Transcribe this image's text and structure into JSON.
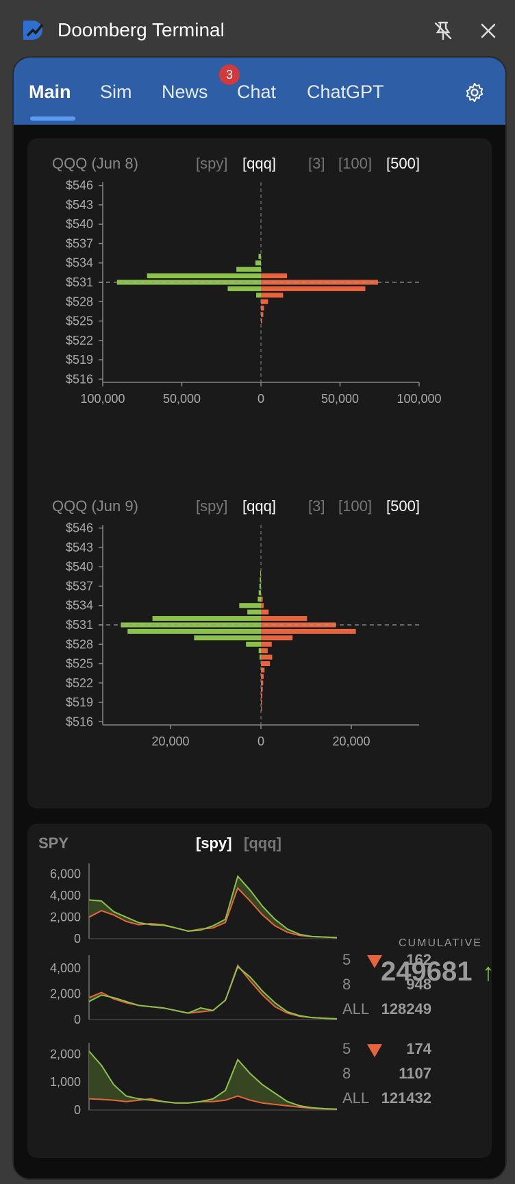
{
  "window": {
    "title": "Doomberg Terminal",
    "pin_icon": "pin-off-icon",
    "close_icon": "close-icon",
    "logo_icon": "doomberg-logo-icon"
  },
  "tabs": [
    {
      "label": "Main",
      "active": true
    },
    {
      "label": "Sim",
      "active": false
    },
    {
      "label": "News",
      "active": false,
      "badge": "3"
    },
    {
      "label": "Chat",
      "active": false
    },
    {
      "label": "ChatGPT",
      "active": false
    }
  ],
  "settings_icon": "gear-icon",
  "colors": {
    "tabbar": "#2e5ea6",
    "green": "#8bc34a",
    "orange": "#e8643c",
    "badge": "#d23a3a"
  },
  "dist_charts": [
    {
      "title": "QQQ (Jun 8)",
      "symbol_options": [
        "[spy]",
        "[qqq]"
      ],
      "selected_symbol": "[qqq]",
      "count_options": [
        "[3]",
        "[100]",
        "[500]"
      ],
      "selected_count": "[500]"
    },
    {
      "title": "QQQ (Jun 9)",
      "symbol_options": [
        "[spy]",
        "[qqq]"
      ],
      "selected_symbol": "[qqq]",
      "count_options": [
        "[3]",
        "[100]",
        "[500]"
      ],
      "selected_count": "[500]"
    }
  ],
  "spy_panel": {
    "title": "SPY",
    "symbol_options": [
      "[spy]",
      "[qqq]"
    ],
    "selected_symbol": "[spy]",
    "cumulative_label": "CUMULATIVE",
    "cumulative_value": "249681",
    "cumulative_arrow": "↑",
    "groups": [
      {
        "rows": [
          {
            "label": "5",
            "value": "162",
            "down": true
          },
          {
            "label": "8",
            "value": "948",
            "down": false
          },
          {
            "label": "ALL",
            "value": "128249",
            "down": false
          }
        ]
      },
      {
        "rows": [
          {
            "label": "5",
            "value": "174",
            "down": true
          },
          {
            "label": "8",
            "value": "1107",
            "down": false
          },
          {
            "label": "ALL",
            "value": "121432",
            "down": false
          }
        ]
      }
    ]
  },
  "chart_data": [
    {
      "type": "bar",
      "orientation": "horizontal-diverging",
      "title": "QQQ (Jun 8)",
      "y_ticks": [
        "$546",
        "$543",
        "$540",
        "$537",
        "$534",
        "$531",
        "$528",
        "$525",
        "$522",
        "$519",
        "$516"
      ],
      "x_ticks": [
        "100,000",
        "50,000",
        "0",
        "50,000",
        "100,000"
      ],
      "xlim": [
        -100000,
        100000
      ],
      "ylim": [
        515.5,
        546.5
      ],
      "reference_price": 531,
      "series": [
        {
          "color": "#8bc34a",
          "side": "left",
          "prices": [
            535,
            534,
            533,
            532,
            531,
            530,
            529
          ],
          "values": [
            1500,
            3500,
            15500,
            72000,
            91000,
            21000,
            3000
          ]
        },
        {
          "color": "#e8643c",
          "side": "right",
          "prices": [
            532,
            531,
            530,
            529,
            528,
            527,
            526,
            525
          ],
          "values": [
            16500,
            74000,
            66000,
            14000,
            4500,
            2000,
            1500,
            800
          ]
        }
      ]
    },
    {
      "type": "bar",
      "orientation": "horizontal-diverging",
      "title": "QQQ (Jun 9)",
      "y_ticks": [
        "$546",
        "$543",
        "$540",
        "$537",
        "$534",
        "$531",
        "$528",
        "$525",
        "$522",
        "$519",
        "$516"
      ],
      "x_ticks": [
        "20,000",
        "0",
        "20,000"
      ],
      "xlim": [
        -35000,
        35000
      ],
      "ylim": [
        515.5,
        546.5
      ],
      "reference_price": 531,
      "series": [
        {
          "color": "#8bc34a",
          "side": "left",
          "prices": [
            539,
            538,
            537,
            536,
            535,
            534,
            533,
            532,
            531,
            530,
            529,
            528,
            527,
            526
          ],
          "values": [
            150,
            250,
            350,
            500,
            700,
            4800,
            3000,
            24000,
            31000,
            29500,
            14800,
            3300,
            500,
            300
          ]
        },
        {
          "color": "#e8643c",
          "side": "right",
          "prices": [
            535,
            534,
            533,
            532,
            531,
            530,
            529,
            528,
            527,
            526,
            525,
            524,
            523,
            522,
            521,
            520,
            519,
            518
          ],
          "values": [
            400,
            600,
            1700,
            10200,
            16600,
            21000,
            7000,
            2400,
            1500,
            2500,
            2000,
            800,
            600,
            500,
            400,
            300,
            250,
            200
          ]
        }
      ]
    },
    {
      "type": "area",
      "title": "SPY",
      "y_ticks": [
        "6,000",
        "4,000",
        "2,000",
        "0"
      ],
      "ylim": [
        0,
        7000
      ],
      "x": [
        0,
        10,
        20,
        30,
        40,
        50,
        60,
        70,
        80,
        90,
        100,
        110,
        120,
        130,
        140,
        150,
        160,
        170,
        180,
        190,
        200
      ],
      "series": [
        {
          "color": "#8bc34a",
          "values": [
            3600,
            3500,
            2500,
            2000,
            1500,
            1300,
            1250,
            1000,
            700,
            800,
            1200,
            1800,
            5800,
            4500,
            3000,
            1800,
            900,
            400,
            200,
            150,
            100
          ]
        },
        {
          "color": "#e8643c",
          "values": [
            2000,
            2600,
            2200,
            1600,
            1300,
            1400,
            1300,
            1000,
            700,
            900,
            1000,
            1500,
            4700,
            3500,
            2200,
            1200,
            600,
            300,
            200,
            150,
            100
          ]
        }
      ]
    },
    {
      "type": "area",
      "title": "",
      "y_ticks": [
        "4,000",
        "2,000",
        "0"
      ],
      "ylim": [
        0,
        5000
      ],
      "x": [
        0,
        10,
        20,
        30,
        40,
        50,
        60,
        70,
        80,
        90,
        100,
        110,
        120,
        130,
        140,
        150,
        160,
        170,
        180,
        190,
        200
      ],
      "series": [
        {
          "color": "#8bc34a",
          "values": [
            1400,
            1900,
            1700,
            1400,
            1100,
            1000,
            900,
            700,
            500,
            900,
            700,
            1500,
            4100,
            3300,
            2200,
            1300,
            600,
            300,
            150,
            100,
            50
          ]
        },
        {
          "color": "#e8643c",
          "values": [
            1700,
            2100,
            1600,
            1300,
            1100,
            1000,
            900,
            700,
            500,
            600,
            700,
            1500,
            4200,
            3000,
            1900,
            1000,
            500,
            250,
            150,
            100,
            50
          ]
        }
      ]
    },
    {
      "type": "area",
      "title": "",
      "y_ticks": [
        "2,000",
        "1,000",
        "0"
      ],
      "ylim": [
        0,
        2400
      ],
      "x": [
        0,
        10,
        20,
        30,
        40,
        50,
        60,
        70,
        80,
        90,
        100,
        110,
        120,
        130,
        140,
        150,
        160,
        170,
        180,
        190,
        200
      ],
      "series": [
        {
          "color": "#8bc34a",
          "values": [
            2100,
            1600,
            900,
            500,
            400,
            350,
            300,
            250,
            250,
            300,
            400,
            700,
            1800,
            1300,
            900,
            600,
            300,
            150,
            80,
            50,
            30
          ]
        },
        {
          "color": "#e8643c",
          "values": [
            400,
            380,
            350,
            300,
            350,
            400,
            300,
            250,
            250,
            300,
            300,
            350,
            500,
            350,
            250,
            200,
            150,
            100,
            60,
            40,
            30
          ]
        }
      ]
    }
  ]
}
